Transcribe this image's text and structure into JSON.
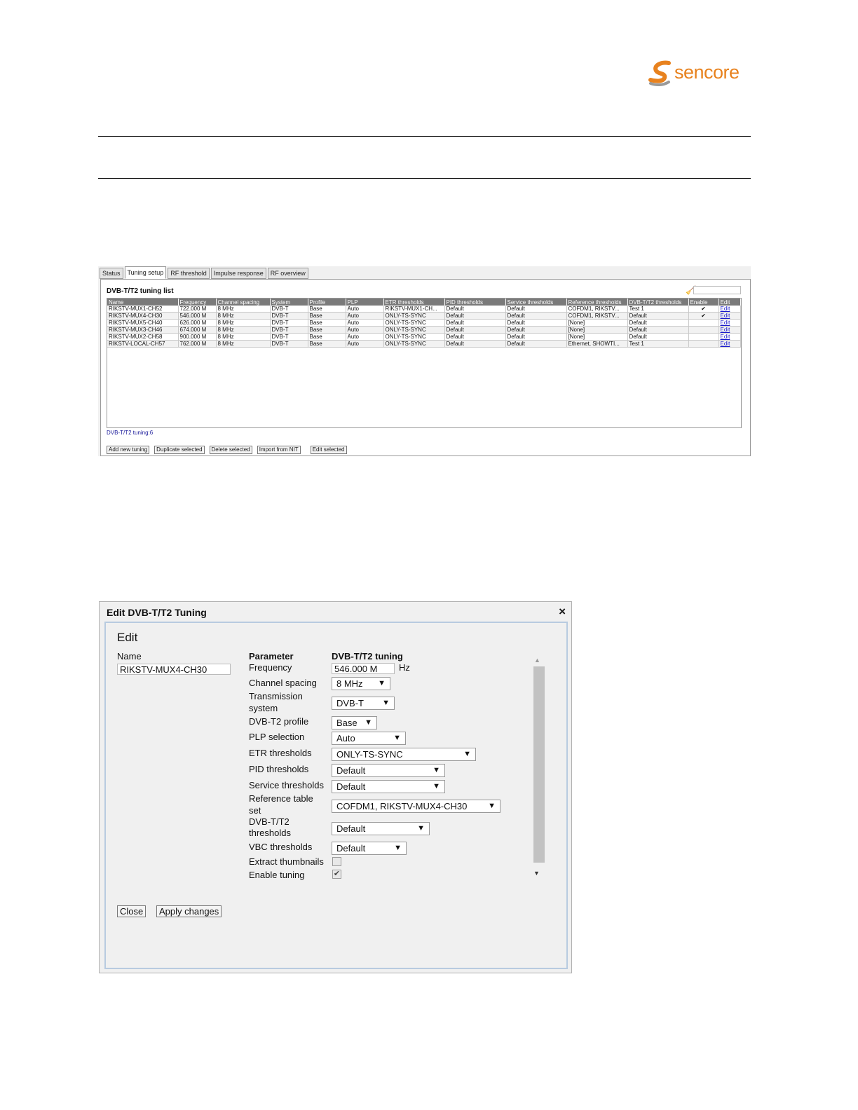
{
  "logo": {
    "text": "sencore",
    "brand_color": "#e8821e"
  },
  "tuning_list": {
    "tabs": [
      "Status",
      "Tuning setup",
      "RF threshold",
      "Impulse response",
      "RF overview"
    ],
    "active_tab": "Tuning setup",
    "title": "DVB-T/T2 tuning list",
    "columns": [
      "Name",
      "Frequency",
      "Channel spacing",
      "System",
      "Profile",
      "PLP",
      "ETR thresholds",
      "PID thresholds",
      "Service thresholds",
      "Reference thresholds",
      "DVB-T/T2 thresholds",
      "Enable",
      "Edit"
    ],
    "rows": [
      [
        "RIKSTV-MUX1-CH52",
        "722.000 M",
        "8 MHz",
        "DVB-T",
        "Base",
        "Auto",
        "RIKSTV-MUX1-CH...",
        "Default",
        "Default",
        "COFDM1, RIKSTV...",
        "Test 1",
        "✔",
        "Edit"
      ],
      [
        "RIKSTV-MUX4-CH30",
        "546.000 M",
        "8 MHz",
        "DVB-T",
        "Base",
        "Auto",
        "ONLY-TS-SYNC",
        "Default",
        "Default",
        "COFDM1, RIKSTV...",
        "Default",
        "✔",
        "Edit"
      ],
      [
        "RIKSTV-MUX5-CH40",
        "626.000 M",
        "8 MHz",
        "DVB-T",
        "Base",
        "Auto",
        "ONLY-TS-SYNC",
        "Default",
        "Default",
        "[None]",
        "Default",
        "",
        "Edit"
      ],
      [
        "RIKSTV-MUX3-CH46",
        "674.000 M",
        "8 MHz",
        "DVB-T",
        "Base",
        "Auto",
        "ONLY-TS-SYNC",
        "Default",
        "Default",
        "[None]",
        "Default",
        "",
        "Edit"
      ],
      [
        "RIKSTV-MUX2-CH58",
        "900.000 M",
        "8 MHz",
        "DVB-T",
        "Base",
        "Auto",
        "ONLY-TS-SYNC",
        "Default",
        "Default",
        "[None]",
        "Default",
        "",
        "Edit"
      ],
      [
        "RIKSTV-LOCAL-CH57",
        "762.000 M",
        "8 MHz",
        "DVB-T",
        "Base",
        "Auto",
        "ONLY-TS-SYNC",
        "Default",
        "Default",
        "Ethernet, SHOWTI...",
        "Test 1",
        "",
        "Edit"
      ]
    ],
    "count_label": "DVB-T/T2 tuning:6",
    "buttons": {
      "add": "Add new tuning",
      "duplicate": "Duplicate selected",
      "delete": "Delete selected",
      "import": "Import from NIT",
      "edit": "Edit selected"
    }
  },
  "edit_dialog": {
    "title": "Edit DVB-T/T2 Tuning",
    "close_icon": "×",
    "heading": "Edit",
    "name_label": "Name",
    "name_value": "RIKSTV-MUX4-CH30",
    "parameter_header": "Parameter",
    "value_header": "DVB-T/T2 tuning",
    "frequency_label": "Frequency",
    "frequency_value": "546.000 M",
    "frequency_unit": "Hz",
    "channel_spacing_label": "Channel spacing",
    "channel_spacing_value": "8 MHz",
    "transmission_label_1": "Transmission",
    "transmission_label_2": "system",
    "transmission_value": "DVB-T",
    "profile_label": "DVB-T2 profile",
    "profile_value": "Base",
    "plp_label": "PLP selection",
    "plp_value": "Auto",
    "etr_label": "ETR thresholds",
    "etr_value": "ONLY-TS-SYNC",
    "pid_label": "PID thresholds",
    "pid_value": "Default",
    "service_label": "Service thresholds",
    "service_value": "Default",
    "reference_label_1": "Reference table",
    "reference_label_2": "set",
    "reference_value": "COFDM1, RIKSTV-MUX4-CH30",
    "t2_label_1": "DVB-T/T2",
    "t2_label_2": "thresholds",
    "t2_value": "Default",
    "vbc_label": "VBC thresholds",
    "vbc_value": "Default",
    "thumbnails_label": "Extract thumbnails",
    "thumbnails_checked": false,
    "enable_label": "Enable tuning",
    "enable_checked": true,
    "close_button": "Close",
    "apply_button": "Apply changes",
    "dropdown_arrow": "▼"
  }
}
